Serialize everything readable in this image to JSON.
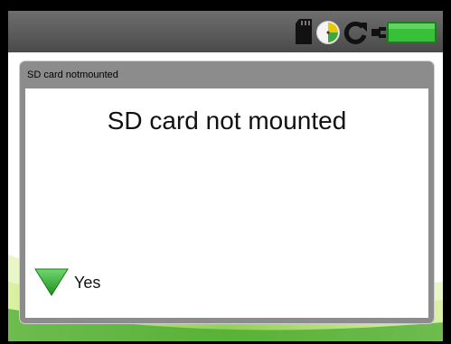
{
  "status_bar": {
    "icons": [
      "sd-card-icon",
      "clock-icon",
      "refresh-icon",
      "battery-charging-icon"
    ],
    "battery_color": "#2fb52f"
  },
  "dialog": {
    "title": "SD card notmounted",
    "message": "SD card not mounted",
    "yes_label": "Yes",
    "accent_color": "#2fa62f"
  }
}
